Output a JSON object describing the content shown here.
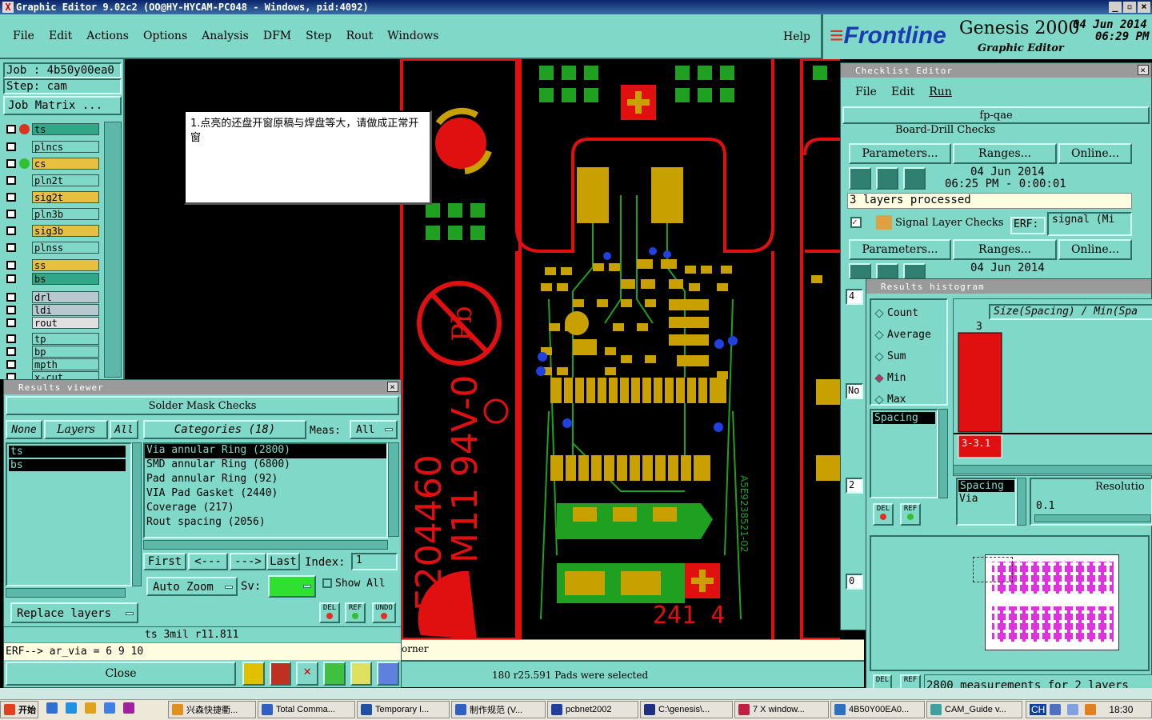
{
  "window": {
    "title": "Graphic Editor 9.02c2 (OO@HY-HYCAM-PC048 - Windows, pid:4092)"
  },
  "menu": [
    "File",
    "Edit",
    "Actions",
    "Options",
    "Analysis",
    "DFM",
    "Step",
    "Rout",
    "Windows"
  ],
  "help": "Help",
  "brand": {
    "logo": "Frontline",
    "product": "Genesis 2000",
    "sub": "Graphic Editor",
    "date": "04 Jun 2014",
    "time": "06:29 PM"
  },
  "job": {
    "job": "Job : 4b50y00ea0",
    "step": "Step: cam",
    "matrix": "Job Matrix ..."
  },
  "layers": [
    {
      "name": "ts",
      "color": "#30a888",
      "ctx": true
    },
    {
      "name": "plncs",
      "color": "#7fd8c8"
    },
    {
      "name": "cs",
      "color": "#e8c040"
    },
    {
      "name": "pln2t",
      "color": "#7fd8c8"
    },
    {
      "name": "sig2t",
      "color": "#e8c040"
    },
    {
      "name": "pln3b",
      "color": "#7fd8c8"
    },
    {
      "name": "sig3b",
      "color": "#e8c040"
    },
    {
      "name": "plnss",
      "color": "#7fd8c8"
    },
    {
      "name": "ss",
      "color": "#e8c040"
    },
    {
      "name": "bs",
      "color": "#30a888"
    },
    {
      "name": "drl",
      "color": "#b8c8d0"
    },
    {
      "name": "ldi",
      "color": "#b8c8d0"
    },
    {
      "name": "rout",
      "color": "#e0e0e0"
    },
    {
      "name": "tp",
      "color": "#7fd8c8"
    },
    {
      "name": "bp",
      "color": "#7fd8c8"
    },
    {
      "name": "mpth",
      "color": "#7fd8c8"
    },
    {
      "name": "x-cut",
      "color": "#7fd8c8"
    }
  ],
  "note": "1.点亮的还盘开窗原稿与焊盘等大，请做成正常开窗",
  "results": {
    "title": "Results viewer",
    "header": "Solder Mask Checks",
    "none": "None",
    "layers_btn": "Layers",
    "all": "All",
    "layer_list": [
      "ts",
      "bs"
    ],
    "categories_btn": "Categories (18)",
    "meas_label": "Meas:",
    "meas_value": "All",
    "categories": [
      "Via annular Ring (2800)",
      "SMD annular Ring (6800)",
      "Pad annular Ring (92)",
      "VIA Pad Gasket (2440)",
      "Coverage (217)",
      "Rout spacing (2056)"
    ],
    "first": "First",
    "prev": "<---",
    "next": "--->",
    "last": "Last",
    "index_label": "Index:",
    "index_value": "1",
    "autozoom": "Auto Zoom",
    "sv": "Sv:",
    "showall": "Show All",
    "replace": "Replace layers",
    "del": "DEL",
    "ref": "REF",
    "undo": "UNDO",
    "status1": "ts 3mil  r11.811",
    "status2": "ERF--> ar_via = 6 9 10",
    "close": "Close"
  },
  "canvas_labels": {
    "corner": "orner",
    "selected": "180 r25.591 Pads were selected",
    "ul1": "E204460",
    "ul2": "M11 94V-0",
    "num": "241 4",
    "small": "A5E9238521-02"
  },
  "checklist": {
    "title": "Checklist Editor",
    "menu": [
      "File",
      "Edit",
      "Run"
    ],
    "name": "fp-qae",
    "row0": "Board-Drill Checks",
    "erf": "ERF:",
    "params": "Parameters...",
    "ranges": "Ranges...",
    "online": "Online...",
    "date1": "04 Jun 2014",
    "time1": "06:25 PM - 0:00:01",
    "processed": "3 layers processed",
    "row1": "Signal Layer Checks",
    "erf_val": "signal (Mi",
    "date2": "04 Jun 2014",
    "side": [
      "4",
      "No",
      "2",
      "0"
    ]
  },
  "histogram": {
    "title": "Results histogram",
    "options": [
      "Count",
      "Average",
      "Sum",
      "Min",
      "Max"
    ],
    "selected": "Min",
    "header": "Size(Spacing) / Min(Spa",
    "bar_value": "3",
    "bar_range": "3- 3.1",
    "list1": [
      "Spacing"
    ],
    "list2": [
      "Spacing",
      "Via"
    ],
    "resolution_label": "Resolutio",
    "resolution_value": "0.1",
    "footer": "2800 measurements for 2 layers",
    "del": "DEL",
    "ref": "REF"
  },
  "chart_data": {
    "type": "bar",
    "categories": [
      "3-3.1"
    ],
    "values": [
      3
    ],
    "ylabel": "",
    "xlabel": "",
    "title": "Size(Spacing) / Min(Spa"
  },
  "taskbar": {
    "start": "开始",
    "items": [
      "兴森快捷衢...",
      "Total Comma...",
      "Temporary I...",
      "制作规范 (V...",
      "pcbnet2002",
      "C:\\genesis\\...",
      "7 X window...",
      "4B50Y00EA0...",
      "CAM_Guide v..."
    ],
    "clock": "18:30",
    "lang": "CH"
  }
}
